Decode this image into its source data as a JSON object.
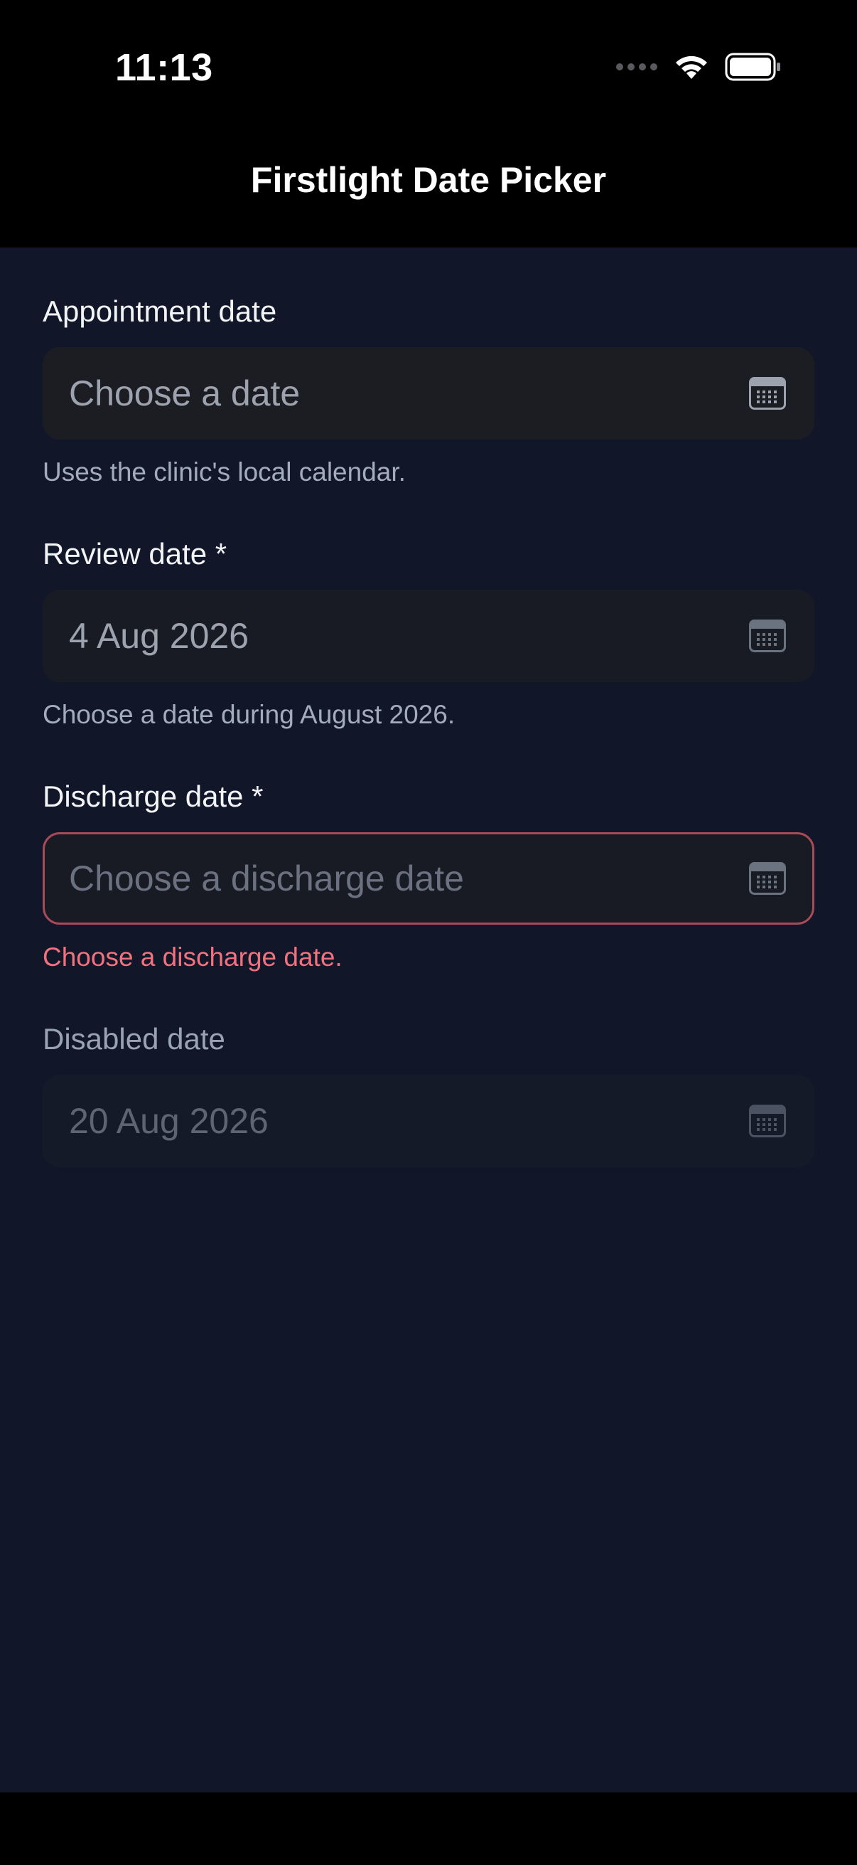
{
  "status_bar": {
    "time": "11:13",
    "icons": [
      "signal-icon",
      "wifi-icon",
      "battery-icon"
    ]
  },
  "header": {
    "title": "Firstlight Date Picker"
  },
  "fields": {
    "appointment": {
      "label": "Appointment date",
      "placeholder": "Choose a date",
      "helper": "Uses the clinic's local calendar.",
      "icon": "calendar-icon"
    },
    "review": {
      "label": "Review date *",
      "value": "4 Aug 2026",
      "helper": "Choose a date during August 2026.",
      "icon": "calendar-icon"
    },
    "discharge": {
      "label": "Discharge date *",
      "placeholder": "Choose a discharge date",
      "error": "Choose a discharge date.",
      "icon": "calendar-icon"
    },
    "disabled": {
      "label": "Disabled date",
      "value": "20 Aug 2026",
      "icon": "calendar-icon"
    }
  },
  "colors": {
    "background": "#111729",
    "error": "#f0727f",
    "error_border": "#a94a58"
  }
}
